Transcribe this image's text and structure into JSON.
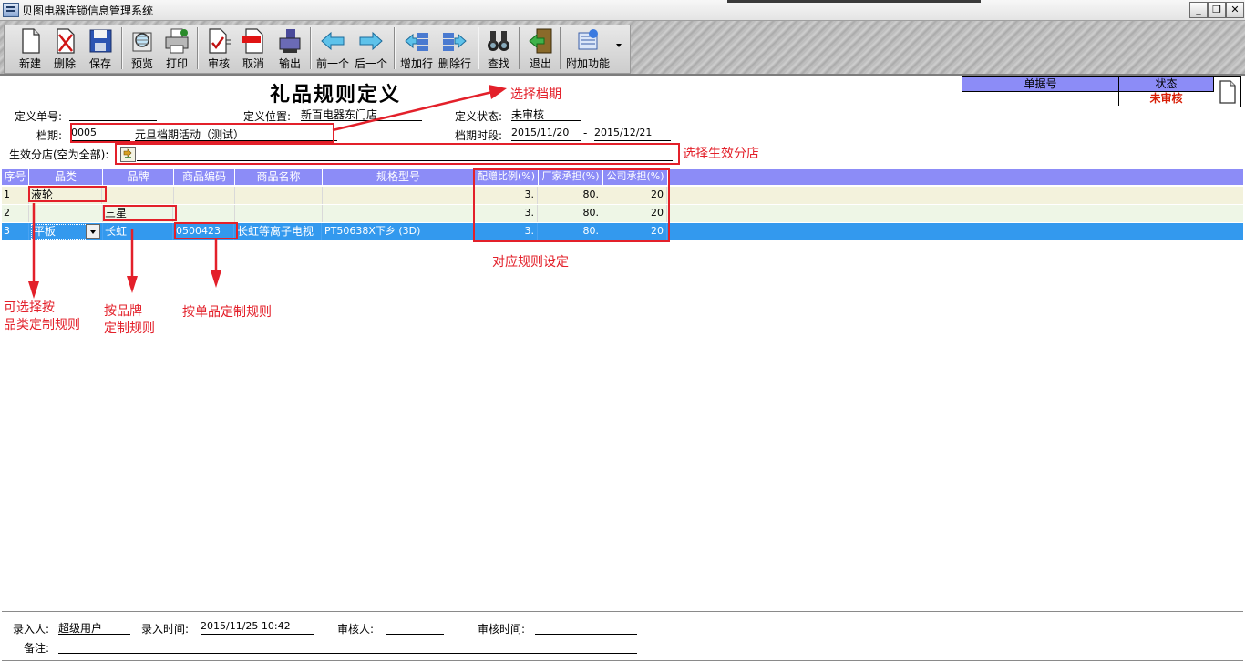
{
  "window": {
    "title": "贝图电器连锁信息管理系统",
    "min": "_",
    "restore": "❐",
    "close": "✕"
  },
  "toolbar": [
    {
      "id": "new",
      "label": "新建",
      "icon": "new-document-icon"
    },
    {
      "id": "delete",
      "label": "删除",
      "icon": "delete-document-icon"
    },
    {
      "id": "save",
      "label": "保存",
      "icon": "floppy-disk-icon"
    },
    {
      "id": "preview",
      "label": "预览",
      "icon": "preview-icon"
    },
    {
      "id": "print",
      "label": "打印",
      "icon": "printer-icon"
    },
    {
      "id": "approve",
      "label": "审核",
      "icon": "approve-icon"
    },
    {
      "id": "cancel",
      "label": "取消",
      "icon": "cancel-icon"
    },
    {
      "id": "export",
      "label": "输出",
      "icon": "export-icon"
    },
    {
      "id": "prev",
      "label": "前一个",
      "icon": "arrow-left-icon"
    },
    {
      "id": "next",
      "label": "后一个",
      "icon": "arrow-right-icon"
    },
    {
      "id": "add_row",
      "label": "增加行",
      "icon": "add-row-icon"
    },
    {
      "id": "del_row",
      "label": "删除行",
      "icon": "delete-row-icon"
    },
    {
      "id": "find",
      "label": "查找",
      "icon": "binoculars-icon"
    },
    {
      "id": "exit",
      "label": "退出",
      "icon": "exit-door-icon"
    },
    {
      "id": "extra",
      "label": "附加功能",
      "icon": "extra-functions-icon"
    }
  ],
  "form": {
    "title": "礼品规则定义",
    "def_no_label": "定义单号:",
    "def_no_value": "",
    "location_label": "定义位置:",
    "location_value": "新百电器东门店",
    "state_label": "定义状态:",
    "state_value": "未审核",
    "period_label": "档期:",
    "period_code": "0005",
    "period_name": "元旦档期活动（测试）",
    "period_time_label": "档期时段:",
    "period_start": "2015/11/20",
    "period_dash": "-",
    "period_end": "2015/12/21",
    "branch_label": "生效分店(空为全部):",
    "branch_value": ""
  },
  "status_box": {
    "doc_no_header": "单据号",
    "doc_no_value": "",
    "state_header": "状态",
    "state_value": "未审核",
    "state_color": "#d81e06"
  },
  "grid": {
    "columns": [
      "序号",
      "品类",
      "品牌",
      "商品编码",
      "商品名称",
      "规格型号",
      "配赠比例(%)",
      "厂家承担(%)",
      "公司承担(%)"
    ],
    "rows": [
      {
        "no": "1",
        "category": "液轮",
        "brand": "",
        "code": "",
        "name": "",
        "spec": "",
        "ratio": "3.",
        "factory": "80.",
        "company": "20"
      },
      {
        "no": "2",
        "category": "",
        "brand": "三星",
        "code": "",
        "name": "",
        "spec": "",
        "ratio": "3.",
        "factory": "80.",
        "company": "20"
      },
      {
        "no": "3",
        "category": "平板",
        "brand": "长虹",
        "code": "0500423",
        "name": "长虹等离子电视",
        "spec": "PT50638X下乡 (3D)",
        "ratio": "3.",
        "factory": "80.",
        "company": "20"
      }
    ],
    "header_color": "#8c8cf7",
    "row1_color": "#f3f2dc",
    "row2_color": "#eef6e6",
    "selected_color": "#3399ee"
  },
  "annotations": {
    "select_period": "选择档期",
    "select_branch": "选择生效分店",
    "rule_setting": "对应规则设定",
    "by_category_1": "可选择按",
    "by_category_2": "品类定制规则",
    "by_brand_1": "按品牌",
    "by_brand_2": "定制规则",
    "by_item": "按单品定制规则",
    "color": "#e3202a"
  },
  "footer": {
    "entry_user_label": "录入人:",
    "entry_user_value": "超级用户",
    "entry_time_label": "录入时间:",
    "entry_time_value": "2015/11/25 10:42",
    "reviewer_label": "审核人:",
    "reviewer_value": "",
    "review_time_label": "审核时间:",
    "review_time_value": "",
    "remark_label": "备注:",
    "remark_value": ""
  }
}
